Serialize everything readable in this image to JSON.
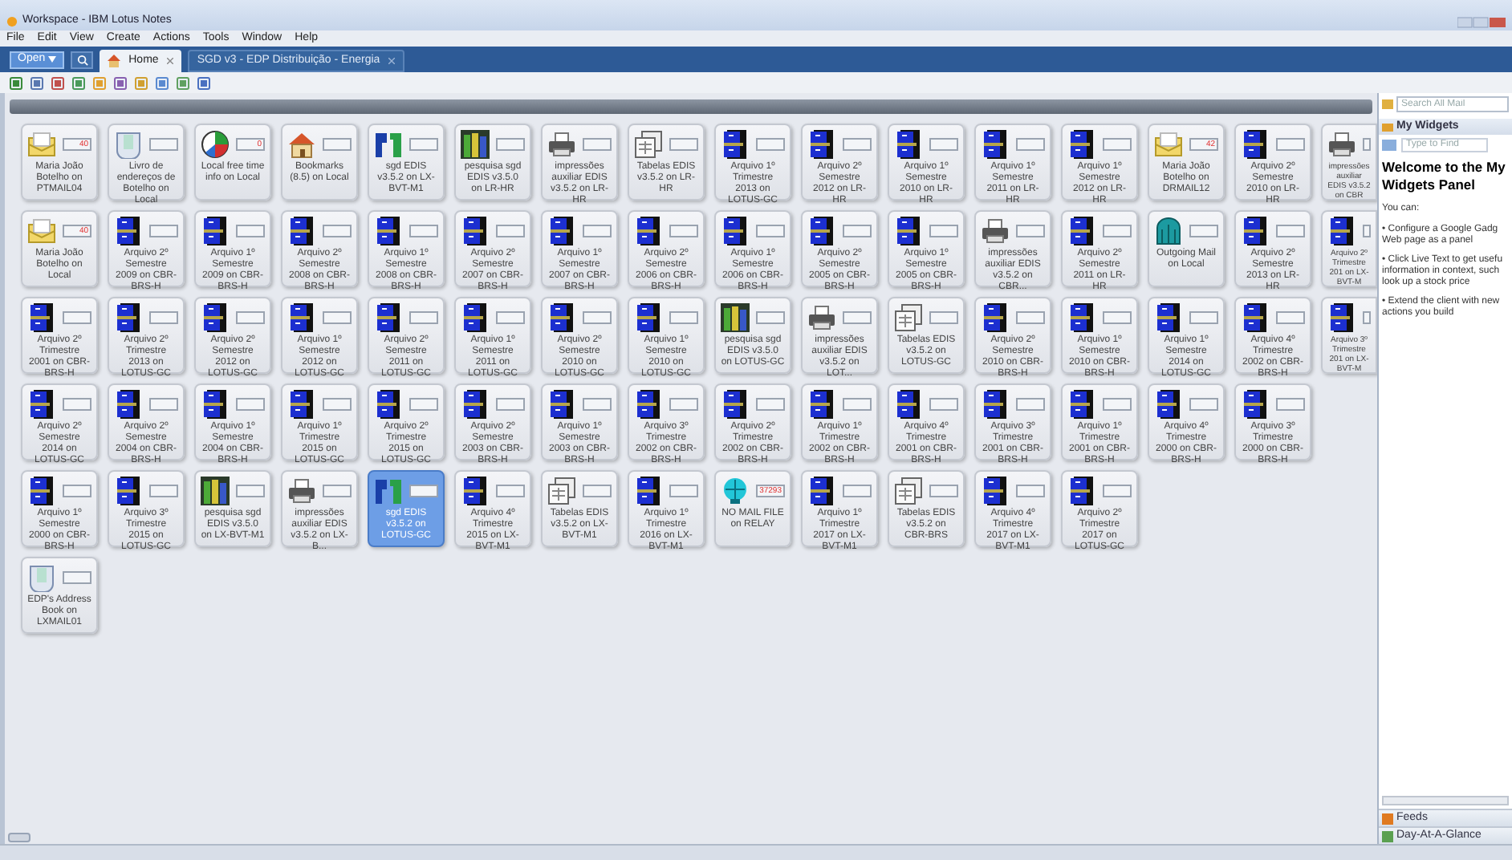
{
  "window": {
    "title": "Workspace - IBM Lotus Notes"
  },
  "menu": [
    "File",
    "Edit",
    "View",
    "Create",
    "Actions",
    "Tools",
    "Window",
    "Help"
  ],
  "open_button": "Open",
  "tabs": [
    {
      "label": "Home",
      "selected": true
    },
    {
      "label": "SGD v3 - EDP Distribuição - Energia",
      "selected": false
    }
  ],
  "rows": [
    {
      "tiles": [
        {
          "kind": "mail",
          "label": "Maria João Botelho on PTMAIL04",
          "count": "40",
          "selected": false
        },
        {
          "kind": "contacts",
          "label": "Livro de endereços de Botelho on Local",
          "selected": false
        },
        {
          "kind": "pie",
          "label": "Local free time info on Local",
          "count": "0",
          "selected": false
        },
        {
          "kind": "bookmarks",
          "label": "Bookmarks (8.5) on Local",
          "selected": false
        },
        {
          "kind": "sgd",
          "label": "sgd EDIS v3.5.2 on LX-BVT-M1",
          "selected": false
        },
        {
          "kind": "books",
          "label": "pesquisa sgd EDIS v3.5.0 on LR-HR",
          "selected": false
        },
        {
          "kind": "printer",
          "label": "impressões auxiliar EDIS v3.5.2 on LR-HR",
          "selected": false
        },
        {
          "kind": "table",
          "label": "Tabelas EDIS v3.5.2 on LR-HR",
          "selected": false
        },
        {
          "kind": "cabinet",
          "label": "Arquivo 1º Trimestre 2013 on LOTUS-GC",
          "selected": false
        },
        {
          "kind": "cabinet",
          "label": "Arquivo 2º Semestre 2012 on LR-HR",
          "selected": false
        },
        {
          "kind": "cabinet",
          "label": "Arquivo 1º Semestre 2010 on LR-HR",
          "selected": false
        },
        {
          "kind": "cabinet",
          "label": "Arquivo 1º Semestre 2011 on LR-HR",
          "selected": false
        },
        {
          "kind": "cabinet",
          "label": "Arquivo 1º Semestre 2012 on LR-HR",
          "selected": false
        },
        {
          "kind": "mail",
          "label": "Maria João Botelho on DRMAIL12",
          "count": "42",
          "selected": false
        },
        {
          "kind": "cabinet",
          "label": "Arquivo 2º Semestre 2010 on LR-HR",
          "selected": false
        },
        {
          "kind": "printer",
          "label": "impressões auxiliar EDIS v3.5.2 on CBR",
          "selected": false
        }
      ]
    },
    {
      "tiles": [
        {
          "kind": "mail",
          "label": "Maria João Botelho on Local",
          "count": "40",
          "selected": false
        },
        {
          "kind": "cabinet",
          "label": "Arquivo 2º Semestre 2009 on CBR-BRS-H",
          "selected": false
        },
        {
          "kind": "cabinet",
          "label": "Arquivo 1º Semestre 2009 on CBR-BRS-H",
          "selected": false
        },
        {
          "kind": "cabinet",
          "label": "Arquivo 2º Semestre 2008 on CBR-BRS-H",
          "selected": false
        },
        {
          "kind": "cabinet",
          "label": "Arquivo 1º Semestre 2008 on CBR-BRS-H",
          "selected": false
        },
        {
          "kind": "cabinet",
          "label": "Arquivo 2º Semestre 2007 on CBR-BRS-H",
          "selected": false
        },
        {
          "kind": "cabinet",
          "label": "Arquivo 1º Semestre 2007 on CBR-BRS-H",
          "selected": false
        },
        {
          "kind": "cabinet",
          "label": "Arquivo 2º Semestre 2006 on CBR-BRS-H",
          "selected": false
        },
        {
          "kind": "cabinet",
          "label": "Arquivo 1º Semestre 2006 on CBR-BRS-H",
          "selected": false
        },
        {
          "kind": "cabinet",
          "label": "Arquivo 2º Semestre 2005 on CBR-BRS-H",
          "selected": false
        },
        {
          "kind": "cabinet",
          "label": "Arquivo 1º Semestre 2005 on CBR-BRS-H",
          "selected": false
        },
        {
          "kind": "printer",
          "label": "impressões auxiliar EDIS v3.5.2 on CBR...",
          "selected": false
        },
        {
          "kind": "cabinet",
          "label": "Arquivo 2º Semestre 2011 on LR-HR",
          "selected": false
        },
        {
          "kind": "outgoing",
          "label": "Outgoing Mail on Local",
          "selected": false
        },
        {
          "kind": "cabinet",
          "label": "Arquivo 2º Semestre 2013 on LR-HR",
          "selected": false
        },
        {
          "kind": "cabinet",
          "label": "Arquivo 2º Trimestre 201 on LX-BVT-M",
          "selected": false
        }
      ]
    },
    {
      "tiles": [
        {
          "kind": "cabinet",
          "label": "Arquivo 2º Trimestre 2001 on CBR-BRS-H",
          "selected": false
        },
        {
          "kind": "cabinet",
          "label": "Arquivo 2º Trimestre 2013 on LOTUS-GC",
          "selected": false
        },
        {
          "kind": "cabinet",
          "label": "Arquivo 2º Semestre 2012 on LOTUS-GC",
          "selected": false
        },
        {
          "kind": "cabinet",
          "label": "Arquivo 1º Semestre 2012 on LOTUS-GC",
          "selected": false
        },
        {
          "kind": "cabinet",
          "label": "Arquivo 2º Semestre 2011 on LOTUS-GC",
          "selected": false
        },
        {
          "kind": "cabinet",
          "label": "Arquivo 1º Semestre 2011 on LOTUS-GC",
          "selected": false
        },
        {
          "kind": "cabinet",
          "label": "Arquivo 2º Semestre 2010 on LOTUS-GC",
          "selected": false
        },
        {
          "kind": "cabinet",
          "label": "Arquivo 1º Semestre 2010 on LOTUS-GC",
          "selected": false
        },
        {
          "kind": "books",
          "label": "pesquisa sgd EDIS v3.5.0 on LOTUS-GC",
          "selected": false
        },
        {
          "kind": "printer",
          "label": "impressões auxiliar EDIS v3.5.2 on LOT...",
          "selected": false
        },
        {
          "kind": "table",
          "label": "Tabelas EDIS v3.5.2 on LOTUS-GC",
          "selected": false
        },
        {
          "kind": "cabinet",
          "label": "Arquivo 2º Semestre 2010 on CBR-BRS-H",
          "selected": false
        },
        {
          "kind": "cabinet",
          "label": "Arquivo 1º Semestre 2010 on CBR-BRS-H",
          "selected": false
        },
        {
          "kind": "cabinet",
          "label": "Arquivo 1º Semestre 2014 on LOTUS-GC",
          "selected": false
        },
        {
          "kind": "cabinet",
          "label": "Arquivo 4º Trimestre 2002 on CBR-BRS-H",
          "selected": false
        },
        {
          "kind": "cabinet",
          "label": "Arquivo 3º Trimestre 201 on LX-BVT-M",
          "selected": false
        }
      ]
    },
    {
      "tiles": [
        {
          "kind": "cabinet",
          "label": "Arquivo 2º Semestre 2014 on LOTUS-GC",
          "selected": false
        },
        {
          "kind": "cabinet",
          "label": "Arquivo 2º Semestre 2004 on CBR-BRS-H",
          "selected": false
        },
        {
          "kind": "cabinet",
          "label": "Arquivo 1º Semestre 2004 on CBR-BRS-H",
          "selected": false
        },
        {
          "kind": "cabinet",
          "label": "Arquivo 1º Trimestre 2015 on LOTUS-GC",
          "selected": false
        },
        {
          "kind": "cabinet",
          "label": "Arquivo 2º Trimestre 2015 on LOTUS-GC",
          "selected": false
        },
        {
          "kind": "cabinet",
          "label": "Arquivo 2º Semestre 2003 on CBR-BRS-H",
          "selected": false
        },
        {
          "kind": "cabinet",
          "label": "Arquivo 1º Semestre 2003 on CBR-BRS-H",
          "selected": false
        },
        {
          "kind": "cabinet",
          "label": "Arquivo 3º Trimestre 2002 on CBR-BRS-H",
          "selected": false
        },
        {
          "kind": "cabinet",
          "label": "Arquivo 2º Trimestre 2002 on CBR-BRS-H",
          "selected": false
        },
        {
          "kind": "cabinet",
          "label": "Arquivo 1º Trimestre 2002 on CBR-BRS-H",
          "selected": false
        },
        {
          "kind": "cabinet",
          "label": "Arquivo 4º Trimestre 2001 on CBR-BRS-H",
          "selected": false
        },
        {
          "kind": "cabinet",
          "label": "Arquivo 3º Trimestre 2001 on CBR-BRS-H",
          "selected": false
        },
        {
          "kind": "cabinet",
          "label": "Arquivo 1º Trimestre 2001 on CBR-BRS-H",
          "selected": false
        },
        {
          "kind": "cabinet",
          "label": "Arquivo 4º Trimestre 2000 on CBR-BRS-H",
          "selected": false
        },
        {
          "kind": "cabinet",
          "label": "Arquivo 3º Trimestre 2000 on CBR-BRS-H",
          "selected": false
        }
      ]
    },
    {
      "tiles": [
        {
          "kind": "cabinet",
          "label": "Arquivo 1º Semestre 2000 on CBR-BRS-H",
          "selected": false
        },
        {
          "kind": "cabinet",
          "label": "Arquivo 3º Trimestre 2015 on LOTUS-GC",
          "selected": false
        },
        {
          "kind": "books",
          "label": "pesquisa sgd EDIS v3.5.0 on LX-BVT-M1",
          "selected": false
        },
        {
          "kind": "printer",
          "label": "impressões auxiliar EDIS v3.5.2 on LX-B...",
          "selected": false
        },
        {
          "kind": "sgd",
          "label": "sgd EDIS v3.5.2 on LOTUS-GC",
          "selected": true
        },
        {
          "kind": "cabinet",
          "label": "Arquivo 4º Trimestre 2015 on LX-BVT-M1",
          "selected": false
        },
        {
          "kind": "table",
          "label": "Tabelas EDIS v3.5.2 on LX-BVT-M1",
          "selected": false
        },
        {
          "kind": "cabinet",
          "label": "Arquivo 1º Trimestre 2016 on LX-BVT-M1",
          "selected": false
        },
        {
          "kind": "nomail",
          "label": "NO MAIL FILE on RELAY",
          "count": "37293",
          "selected": false
        },
        {
          "kind": "cabinet",
          "label": "Arquivo 1º Trimestre 2017 on LX-BVT-M1",
          "selected": false
        },
        {
          "kind": "table",
          "label": "Tabelas EDIS v3.5.2 on CBR-BRS",
          "selected": false
        },
        {
          "kind": "cabinet",
          "label": "Arquivo 4º Trimestre 2017 on LX-BVT-M1",
          "selected": false
        },
        {
          "kind": "cabinet",
          "label": "Arquivo 2º Trimestre 2017 on LOTUS-GC",
          "selected": false
        }
      ]
    },
    {
      "tiles": [
        {
          "kind": "contacts",
          "label": "EDP's Address Book on LXMAIL01",
          "selected": false
        }
      ]
    }
  ],
  "side_panel": {
    "search": {
      "placeholder": "Search All Mail"
    },
    "title": "My Widgets",
    "find": {
      "placeholder": "Type to Find"
    },
    "heading": "Welcome to the My Widgets Panel",
    "intro": "You can:",
    "bullets": [
      [
        "• Configure a Google Gadg",
        "Web page as a panel"
      ],
      [
        "• Click Live Text to get usefu",
        "information in context, such",
        "look up a stock price"
      ],
      [
        "• Extend the client with new",
        "actions you build"
      ]
    ],
    "sections": [
      "Feeds",
      "Day-At-A-Glance"
    ]
  }
}
